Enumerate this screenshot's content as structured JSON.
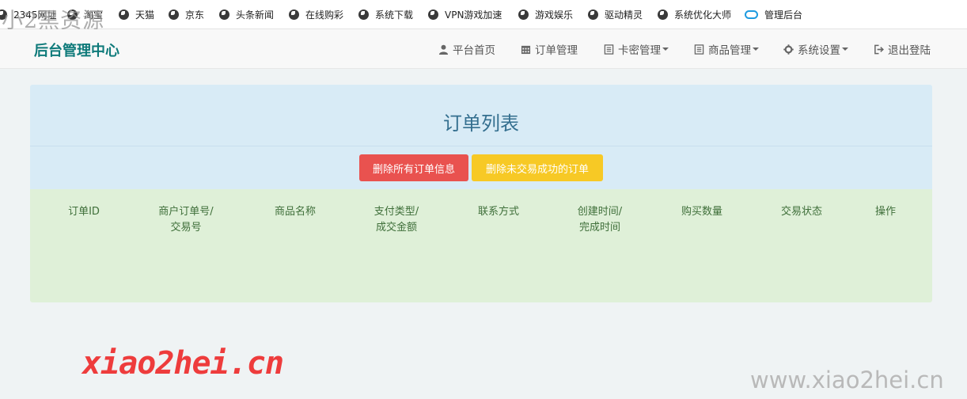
{
  "bookmarks": [
    {
      "label": "2345网址",
      "icon": "globe-icon"
    },
    {
      "label": "淘宝",
      "icon": "globe-icon"
    },
    {
      "label": "天猫",
      "icon": "globe-icon"
    },
    {
      "label": "京东",
      "icon": "globe-icon"
    },
    {
      "label": "头条新闻",
      "icon": "globe-icon"
    },
    {
      "label": "在线购彩",
      "icon": "globe-icon"
    },
    {
      "label": "系统下载",
      "icon": "globe-icon"
    },
    {
      "label": "VPN游戏加速",
      "icon": "globe-icon"
    },
    {
      "label": "游戏娱乐",
      "icon": "globe-icon"
    },
    {
      "label": "驱动精灵",
      "icon": "globe-icon"
    },
    {
      "label": "系统优化大师",
      "icon": "globe-icon"
    },
    {
      "label": "管理后台",
      "icon": "cloud-icon"
    }
  ],
  "watermark_top": "小2黑资源",
  "navbar": {
    "brand": "后台管理中心",
    "items": [
      {
        "label": "平台首页",
        "icon": "user-icon",
        "dropdown": false
      },
      {
        "label": "订单管理",
        "icon": "calendar-icon",
        "dropdown": false
      },
      {
        "label": "卡密管理",
        "icon": "list-icon",
        "dropdown": true
      },
      {
        "label": "商品管理",
        "icon": "list-icon",
        "dropdown": true
      },
      {
        "label": "系统设置",
        "icon": "gear-icon",
        "dropdown": true
      },
      {
        "label": "退出登陆",
        "icon": "logout-icon",
        "dropdown": false
      }
    ]
  },
  "panel": {
    "title": "订单列表",
    "buttons": {
      "delete_all": "删除所有订单信息",
      "delete_failed": "删除未交易成功的订单"
    },
    "columns": [
      [
        "订单ID"
      ],
      [
        "商户订单号/",
        "交易号"
      ],
      [
        "商品名称"
      ],
      [
        "支付类型/",
        "成交金额"
      ],
      [
        "联系方式"
      ],
      [
        "创建时间/",
        "完成时间"
      ],
      [
        "购买数量"
      ],
      [
        "交易状态"
      ],
      [
        "操作"
      ]
    ]
  },
  "watermark_bottom_left": "xiao2hei.cn",
  "watermark_bottom_right": "www.xiao2hei.cn",
  "colors": {
    "brand": "#0e7a7a",
    "danger": "#e9524f",
    "warning": "#f7c925",
    "info_bg": "#d8ebf6",
    "success_bg": "#dff0d8"
  }
}
